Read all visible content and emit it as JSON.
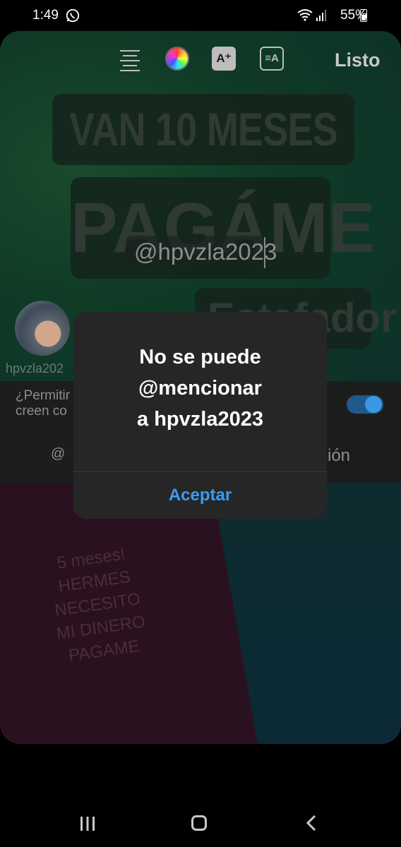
{
  "status_bar": {
    "time": "1:49",
    "battery": "55%"
  },
  "toolbar": {
    "done_label": "Listo",
    "effects_icon_glyph": "A⁺",
    "textstyle_icon_glyph": "≡A"
  },
  "story": {
    "line1": "VAN 10 MESES",
    "line2": "PAGÁME",
    "line3": "Estafador",
    "mention_text": "@hpvzla2023",
    "note": "5 meses!\nHERMES\nNECESITO\nMI DINERO\nPAGAME"
  },
  "mention_suggestion": {
    "username": "hpvzla202",
    "permission_text_line1": "¿Permitir",
    "permission_text_line2": "creen co",
    "tab_mention": "@",
    "tab_location": "ción"
  },
  "dialog": {
    "title_line1": "No se puede",
    "title_line2": "@mencionar",
    "title_line3": "a hpvzla2023",
    "button_label": "Aceptar"
  },
  "colors": {
    "accent": "#3b9cf0",
    "dialog_bg": "#262626"
  }
}
